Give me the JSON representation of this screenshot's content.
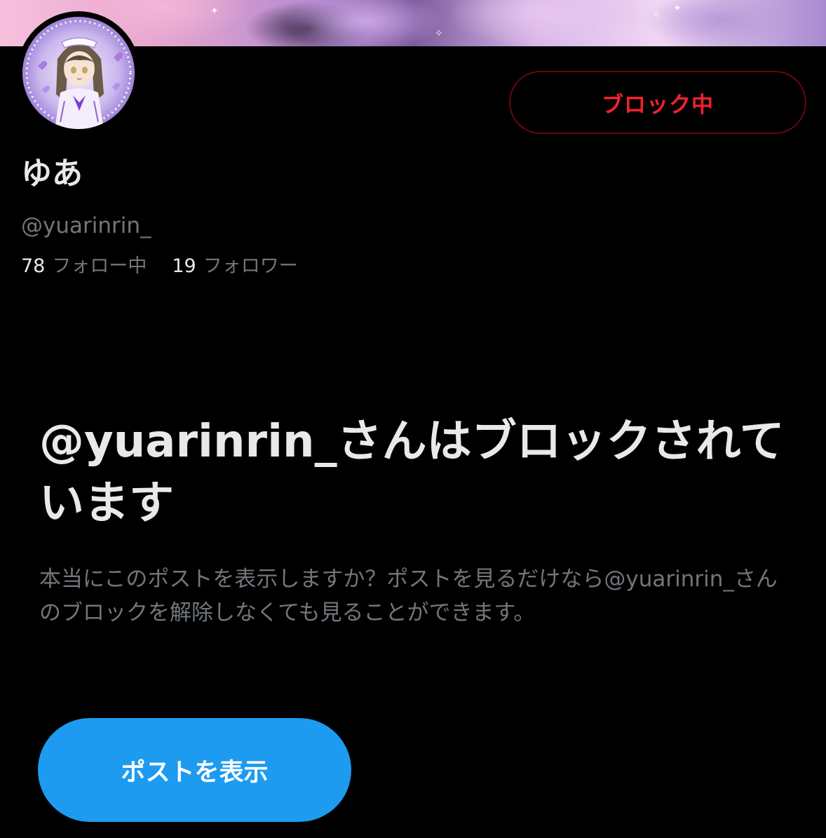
{
  "profile": {
    "display_name": "ゆあ",
    "handle": "@yuarinrin_",
    "following_count": "78",
    "following_label": "フォロー中",
    "followers_count": "19",
    "followers_label": "フォロワー"
  },
  "block_button": {
    "label": "ブロック中"
  },
  "blocked_notice": {
    "title": "@yuarinrin_さんはブロックされています",
    "description": "本当にこのポストを表示しますか？ポストを見るだけなら@yuarinrin_さんのブロックを解除しなくても見ることができます。",
    "view_button_label": "ポストを表示"
  },
  "colors": {
    "background": "#000000",
    "primary_text": "#e7e9ea",
    "secondary_text": "#71767b",
    "blocked_red": "#f4212e",
    "blocked_border": "#67070f",
    "accent_blue": "#1d9bf0"
  }
}
